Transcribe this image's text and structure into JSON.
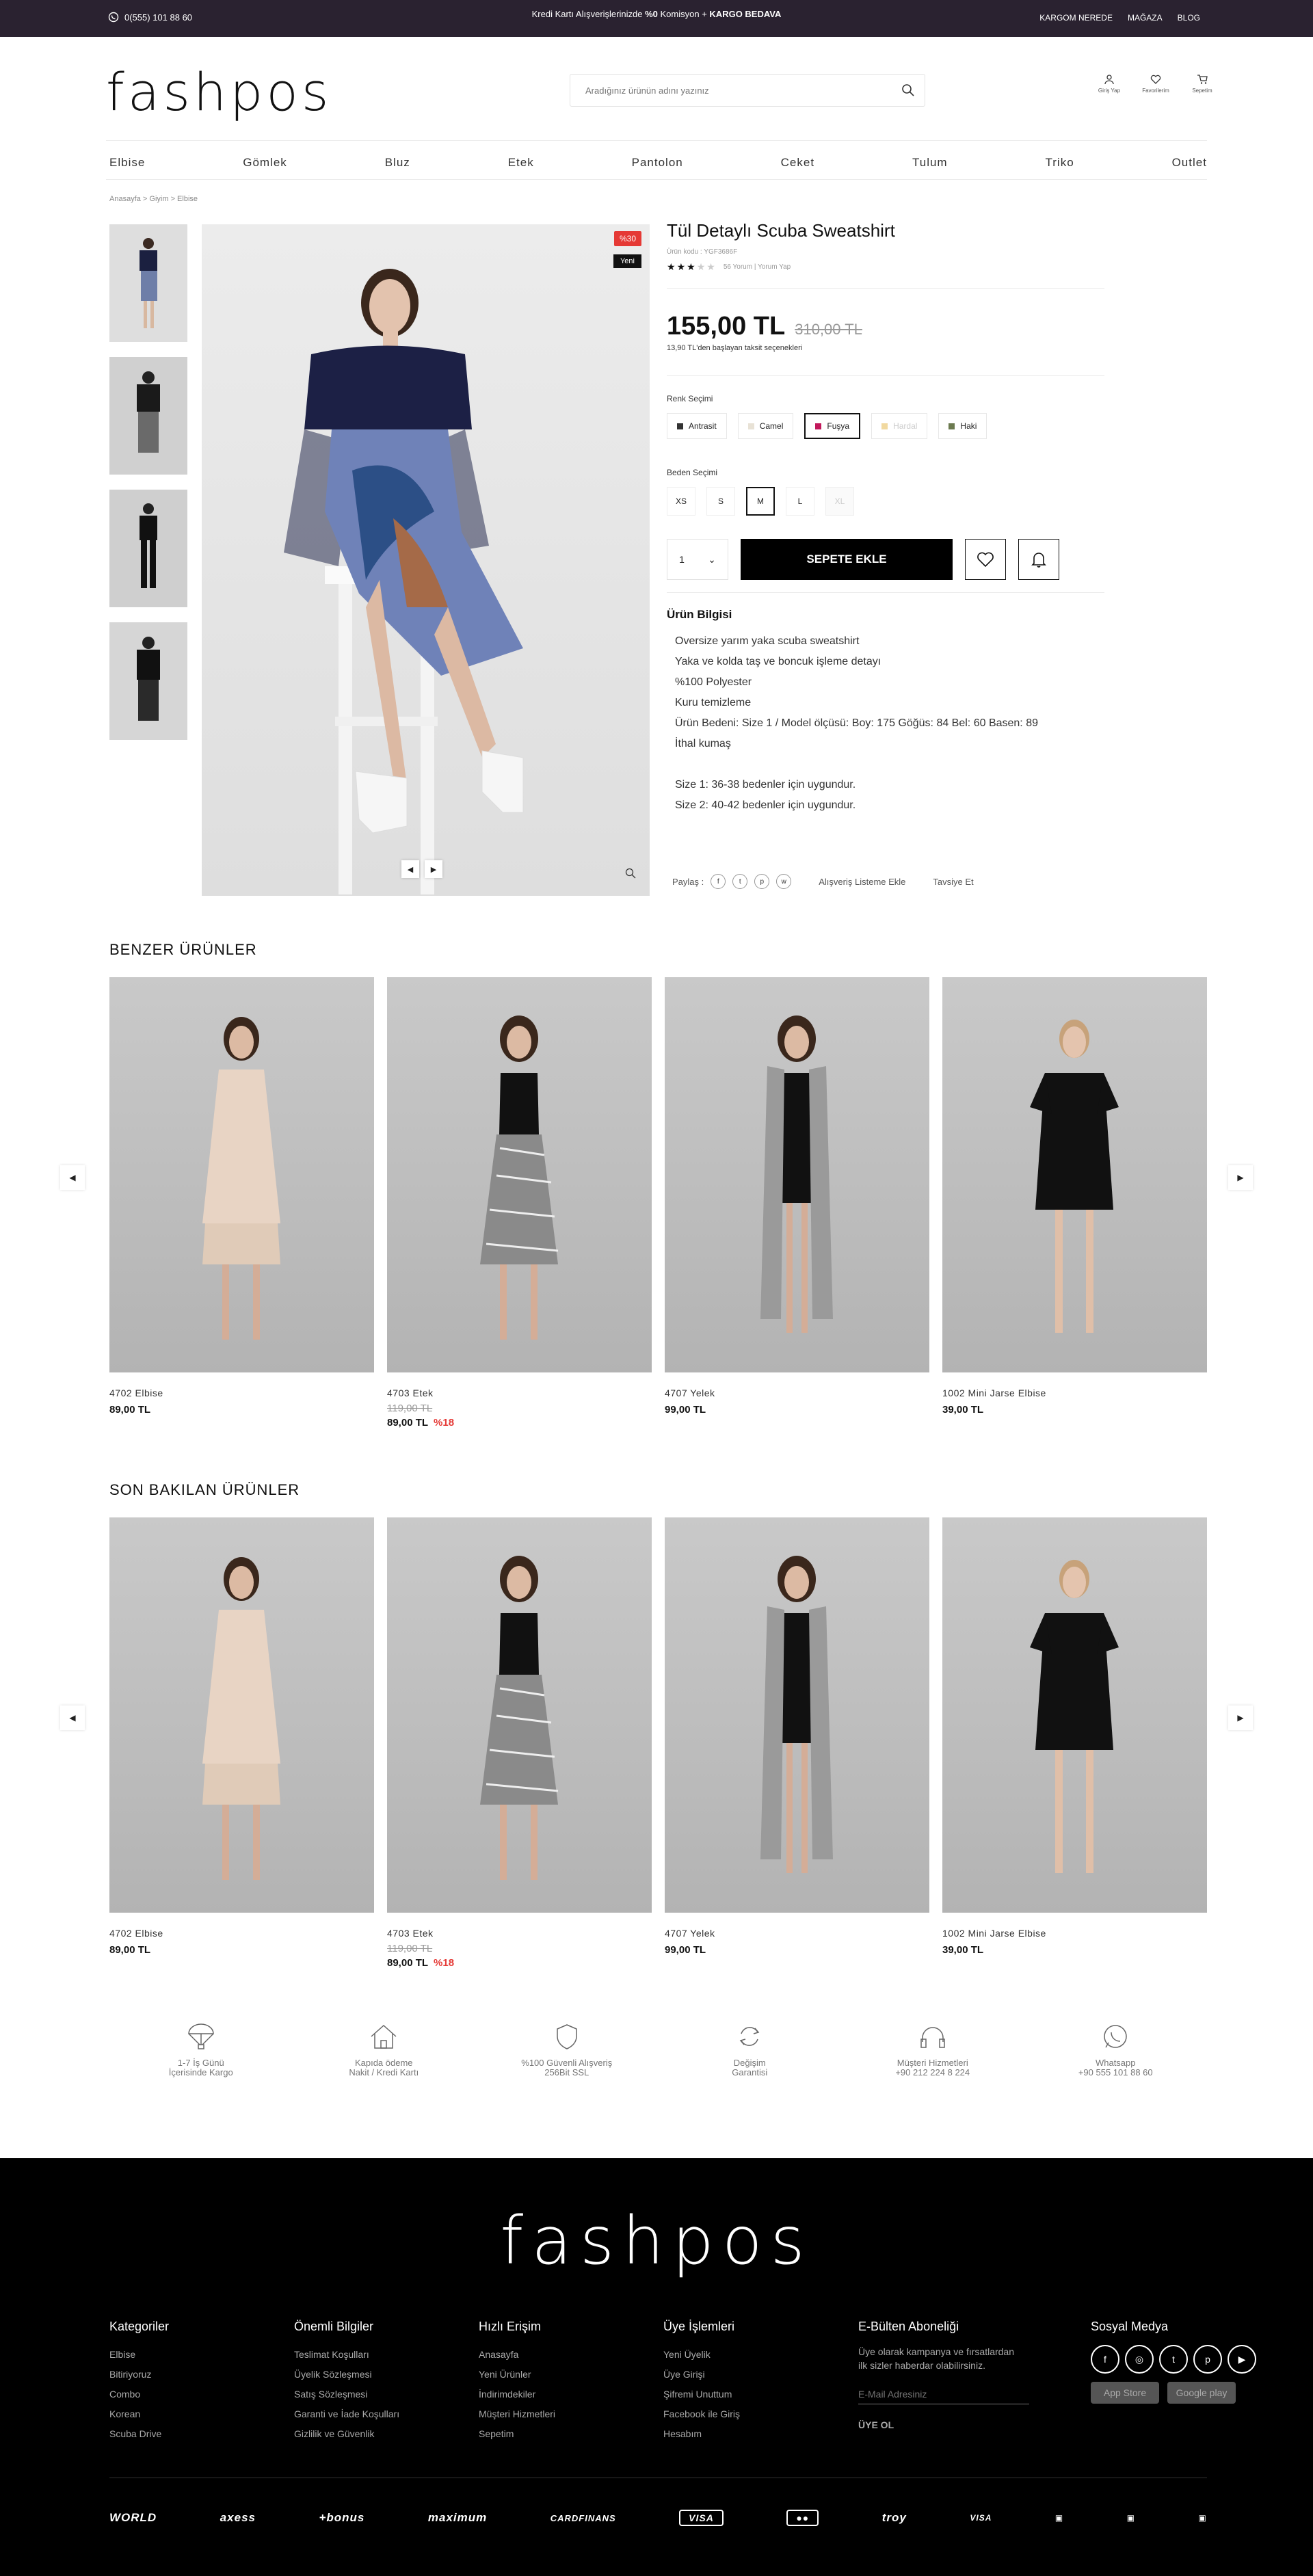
{
  "topbar": {
    "phone": "0(555) 101 88 60",
    "promo_prefix": "Kredi Kartı Alışverişlerinizde",
    "promo_bold1": "%0",
    "promo_mid": "Komisyon +",
    "promo_bold2": "KARGO BEDAVA",
    "links": [
      "KARGOM NEREDE",
      "MAĞAZA",
      "BLOG"
    ]
  },
  "header": {
    "logo": "fashpos",
    "search_placeholder": "Aradığınız ürünün adını yazınız",
    "icons": [
      "Giriş Yap",
      "Favorilerim",
      "Sepetim"
    ]
  },
  "nav": [
    "Elbise",
    "Gömlek",
    "Bluz",
    "Etek",
    "Pantolon",
    "Ceket",
    "Tulum",
    "Triko",
    "Outlet"
  ],
  "breadcrumb": "Anasayfa  >  Giyim  >  Elbise",
  "product": {
    "badge_discount": "%30",
    "badge_new": "Yeni",
    "title": "Tül Detaylı Scuba Sweatshirt",
    "code": "Ürün kodu : YGF3686F",
    "rating_meta": "56 Yorum | Yorum Yap",
    "rating": 3,
    "price": "155,00 TL",
    "old_price": "310,00 TL",
    "installment": "13,90 TL'den başlayan taksit seçenekleri",
    "color_label": "Renk Seçimi",
    "colors": [
      {
        "name": "Antrasit",
        "hex": "#333333"
      },
      {
        "name": "Camel",
        "hex": "#e8e2d6"
      },
      {
        "name": "Fuşya",
        "hex": "#c2185b"
      },
      {
        "name": "Hardal",
        "hex": "#f1d9a0"
      },
      {
        "name": "Haki",
        "hex": "#6b7a4f"
      }
    ],
    "size_label": "Beden Seçimi",
    "sizes": [
      "XS",
      "S",
      "M",
      "L",
      "XL"
    ],
    "qty": "1",
    "add_to_cart": "SEPETE EKLE",
    "info_title": "Ürün Bilgisi",
    "info": [
      "Oversize yarım yaka scuba sweatshirt",
      "Yaka ve kolda taş ve boncuk işleme detayı",
      "%100 Polyester",
      "Kuru temizleme",
      "Ürün Bedeni: Size 1 / Model ölçüsü: Boy: 175 Göğüs: 84 Bel: 60 Basen: 89",
      "İthal kumaş",
      "",
      "Size 1: 36-38 bedenler için uygundur.",
      "Size 2: 40-42 bedenler için uygundur."
    ],
    "share_label": "Paylaş :",
    "wishlist_link": "Alışveriş Listeme Ekle",
    "recommend_link": "Tavsiye Et"
  },
  "similar": {
    "title": "BENZER ÜRÜNLER",
    "items": [
      {
        "name": "4702 Elbise",
        "price": "89,00 TL",
        "old": "",
        "disc": ""
      },
      {
        "name": "4703 Etek",
        "price": "89,00 TL",
        "old": "119,00 TL",
        "disc": "%18"
      },
      {
        "name": "4707 Yelek",
        "price": "99,00 TL",
        "old": "",
        "disc": ""
      },
      {
        "name": "1002 Mini Jarse Elbise",
        "price": "39,00 TL",
        "old": "",
        "disc": ""
      }
    ]
  },
  "recent": {
    "title": "SON BAKILAN ÜRÜNLER",
    "items": [
      {
        "name": "4702 Elbise",
        "price": "89,00 TL",
        "old": "",
        "disc": ""
      },
      {
        "name": "4703 Etek",
        "price": "89,00 TL",
        "old": "119,00 TL",
        "disc": "%18"
      },
      {
        "name": "4707 Yelek",
        "price": "99,00 TL",
        "old": "",
        "disc": ""
      },
      {
        "name": "1002 Mini Jarse Elbise",
        "price": "39,00 TL",
        "old": "",
        "disc": ""
      }
    ]
  },
  "features": [
    {
      "l1": "1-7 İş Günü",
      "l2": "İçerisinde Kargo"
    },
    {
      "l1": "Kapıda ödeme",
      "l2": "Nakit / Kredi Kartı"
    },
    {
      "l1": "%100 Güvenli Alışveriş",
      "l2": "256Bit SSL"
    },
    {
      "l1": "Değişim",
      "l2": "Garantisi"
    },
    {
      "l1": "Müşteri Hizmetleri",
      "l2": "+90 212 224 8 224"
    },
    {
      "l1": "Whatsapp",
      "l2": "+90 555 101 88 60"
    }
  ],
  "footer": {
    "logo": "fashpos",
    "cols": [
      {
        "title": "Kategoriler",
        "items": [
          "Elbise",
          "Bitiriyoruz",
          "Combo",
          "Korean",
          "Scuba Drive"
        ]
      },
      {
        "title": "Önemli Bilgiler",
        "items": [
          "Teslimat Koşulları",
          "Üyelik Sözleşmesi",
          "Satış Sözleşmesi",
          "Garanti ve İade Koşulları",
          "Gizlilik ve Güvenlik"
        ]
      },
      {
        "title": "Hızlı Erişim",
        "items": [
          "Anasayfa",
          "Yeni Ürünler",
          "İndirimdekiler",
          "Müşteri Hizmetleri",
          "Sepetim"
        ]
      },
      {
        "title": "Üye İşlemleri",
        "items": [
          "Yeni Üyelik",
          "Üye Girişi",
          "Şifremi Unuttum",
          "Facebook ile Giriş",
          "Hesabım"
        ]
      }
    ],
    "newsletter": {
      "title": "E-Bülten Aboneliği",
      "text1": "Üye olarak kampanya ve fırsatlardan",
      "text2": "ilk sizler haberdar olabilirsiniz.",
      "placeholder": "E-Mail Adresiniz",
      "join": "ÜYE OL"
    },
    "social_title": "Sosyal Medya",
    "social": [
      "f",
      "◎",
      "t",
      "p",
      "▶"
    ],
    "apps": [
      "App Store",
      "Google play"
    ],
    "payments": [
      "WORLD",
      "axess",
      "+bonus",
      "maximum",
      "CARDFINANS",
      "VISA",
      "●●",
      "troy",
      "VISA",
      "▣",
      "▣",
      "▣"
    ]
  }
}
